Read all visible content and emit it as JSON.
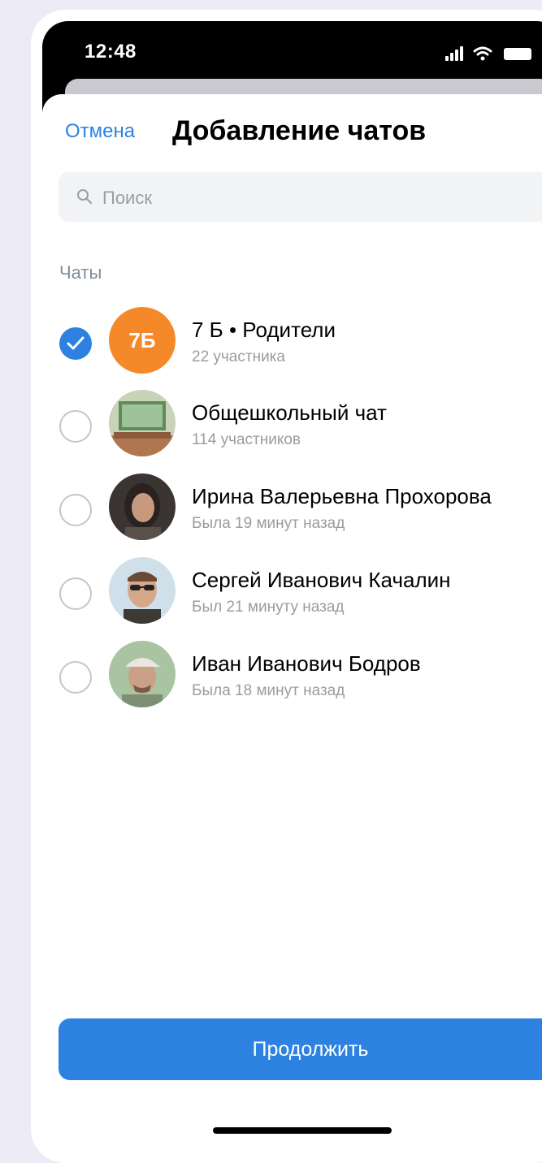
{
  "status_bar": {
    "time": "12:48",
    "icons": [
      "signal-icon",
      "wifi-icon",
      "battery-icon"
    ]
  },
  "header": {
    "cancel_label": "Отмена",
    "title": "Добавление чатов"
  },
  "search": {
    "placeholder": "Поиск",
    "value": ""
  },
  "section": {
    "label": "Чаты"
  },
  "chats": [
    {
      "name": "7 Б • Родители",
      "subtitle": "22 участника",
      "selected": true,
      "avatar": {
        "type": "initials",
        "text": "7Б",
        "color": "#f5892a"
      }
    },
    {
      "name": "Общешкольный чат",
      "subtitle": "114 участников",
      "selected": false,
      "avatar": {
        "type": "photo",
        "depicts": "classroom"
      }
    },
    {
      "name": "Ирина Валерьевна Прохорова",
      "subtitle": "Была 19 минут назад",
      "selected": false,
      "avatar": {
        "type": "photo",
        "depicts": "woman-portrait"
      }
    },
    {
      "name": "Сергей Иванович Качалин",
      "subtitle": "Был 21 минуту назад",
      "selected": false,
      "avatar": {
        "type": "photo",
        "depicts": "man-sunglasses-portrait"
      }
    },
    {
      "name": "Иван Иванович Бодров",
      "subtitle": "Была 18 минут назад",
      "selected": false,
      "avatar": {
        "type": "photo",
        "depicts": "man-cap-portrait"
      }
    }
  ],
  "footer": {
    "continue_label": "Продолжить"
  },
  "colors": {
    "accent": "#2d81e0",
    "avatar_orange": "#f5892a",
    "secondary_text": "#9a9ca2",
    "section_text": "#818c99",
    "page_background": "#ecebf6"
  }
}
